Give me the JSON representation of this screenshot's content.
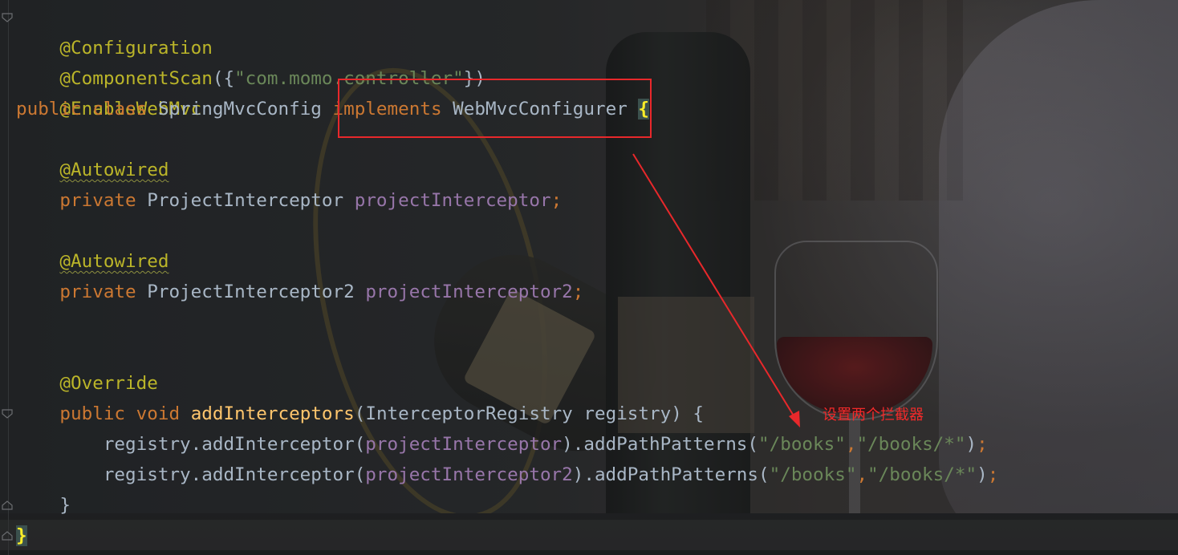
{
  "colors": {
    "keyword": "#cc7832",
    "annotation": "#bbb529",
    "string": "#6a8759",
    "field": "#9876aa",
    "method": "#ffc66d",
    "plain": "#a9b7c6",
    "highlight_box": "#e8282b"
  },
  "code": {
    "l1": {
      "annotation": "@Configuration"
    },
    "l2": {
      "annotation": "@ComponentScan",
      "open": "({",
      "string": "\"com.momo.controller\"",
      "close": "})"
    },
    "l3": {
      "annotation": "@EnableWebMvc"
    },
    "l4": {
      "public": "public",
      "class": "class",
      "name": "SpringMvcConfig",
      "implements": "implements",
      "iface": "WebMvcConfigurer",
      "brace": "{"
    },
    "l6": {
      "annotation": "@Autowired"
    },
    "l7": {
      "private": "private",
      "type": "ProjectInterceptor",
      "field": "projectInterceptor",
      "semi": ";"
    },
    "l9": {
      "annotation": "@Autowired"
    },
    "l10": {
      "private": "private",
      "type": "ProjectInterceptor2",
      "field": "projectInterceptor2",
      "semi": ";"
    },
    "l13": {
      "annotation": "@Override"
    },
    "l14": {
      "public": "public",
      "void": "void",
      "method": "addInterceptors",
      "params": "(InterceptorRegistry registry) {"
    },
    "l15": {
      "head": "registry.addInterceptor(",
      "field": "projectInterceptor",
      "mid": ").addPathPatterns(",
      "s1": "\"/books\"",
      "comma": ",",
      "s2": "\"/books/*\"",
      "tail": ")",
      "semi": ";"
    },
    "l16": {
      "head": "registry.addInterceptor(",
      "field": "projectInterceptor2",
      "mid": ").addPathPatterns(",
      "s1": "\"/books\"",
      "comma": ",",
      "s2": "\"/books/*\"",
      "tail": ")",
      "semi": ";"
    },
    "l17": {
      "text": "}"
    },
    "l18": {
      "text": "}"
    }
  },
  "annotation_note": "设置两个拦截器"
}
